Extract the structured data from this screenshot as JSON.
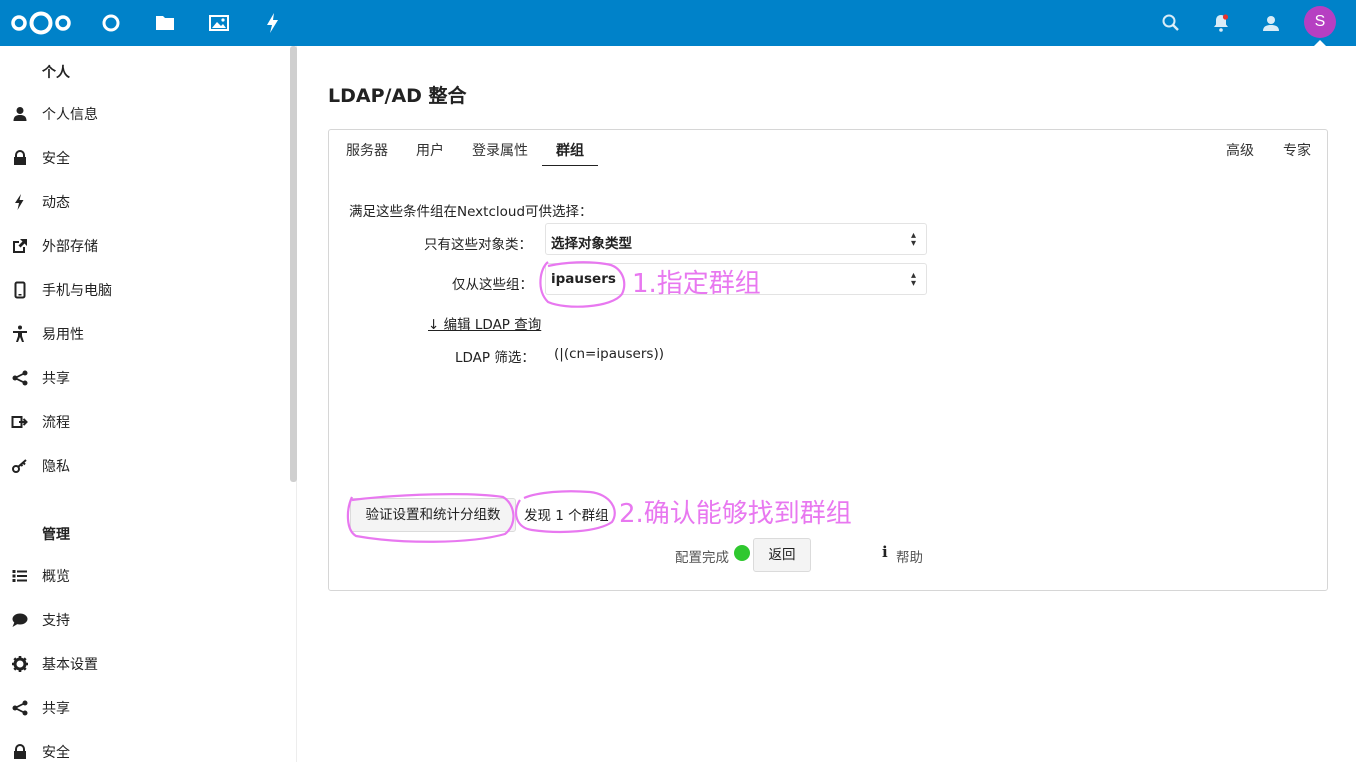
{
  "header": {
    "apps": [
      "dashboard-icon",
      "files-icon",
      "photos-icon",
      "activity-icon"
    ],
    "right_icons": [
      "search-icon",
      "notifications-icon",
      "contacts-icon"
    ],
    "avatar_letter": "S",
    "brand_color": "#0082c9",
    "avatar_color": "#b63fc2"
  },
  "sidebar": {
    "personal_title": "个人",
    "personal_items": [
      {
        "label": "个人信息",
        "icon": "user-icon"
      },
      {
        "label": "安全",
        "icon": "lock-icon"
      },
      {
        "label": "动态",
        "icon": "lightning-icon"
      },
      {
        "label": "外部存储",
        "icon": "external-link-icon"
      },
      {
        "label": "手机与电脑",
        "icon": "phone-icon"
      },
      {
        "label": "易用性",
        "icon": "accessibility-icon"
      },
      {
        "label": "共享",
        "icon": "share-icon"
      },
      {
        "label": "流程",
        "icon": "flow-icon"
      },
      {
        "label": "隐私",
        "icon": "key-icon"
      }
    ],
    "admin_title": "管理",
    "admin_items": [
      {
        "label": "概览",
        "icon": "list-icon"
      },
      {
        "label": "支持",
        "icon": "chat-icon"
      },
      {
        "label": "基本设置",
        "icon": "gear-icon"
      },
      {
        "label": "共享",
        "icon": "share-icon"
      },
      {
        "label": "安全",
        "icon": "lock-icon"
      }
    ]
  },
  "main": {
    "title": "LDAP/AD 整合",
    "tabs_left": [
      "服务器",
      "用户",
      "登录属性",
      "群组"
    ],
    "active_tab": "群组",
    "tabs_right": [
      "高级",
      "专家"
    ],
    "description": "满足这些条件组在Nextcloud可供选择：",
    "object_class_label": "只有这些对象类：",
    "object_class_value": "选择对象类型",
    "groups_label": "仅从这些组：",
    "groups_value": "ipausers",
    "edit_query_link": "↓ 编辑 LDAP 查询",
    "filter_label": "LDAP 筛选：",
    "filter_value": "(|(cn=ipausers))",
    "verify_button": "验证设置和统计分组数",
    "found_text": "发现 1 个群组",
    "config_status": "配置完成",
    "status_color": "#2fc82f",
    "back_button": "返回",
    "help_label": "帮助"
  },
  "annotations": {
    "step1": "1.指定群组",
    "step2": "2.确认能够找到群组",
    "color": "#e878f0"
  }
}
